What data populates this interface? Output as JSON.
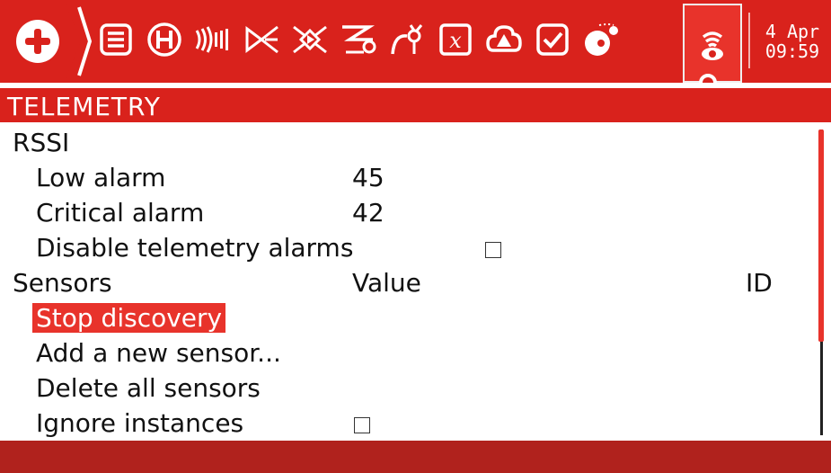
{
  "header": {
    "date": "4 Apr",
    "time": "09:59",
    "tabs": [
      {
        "icon": "checklist-icon"
      },
      {
        "icon": "heli-h-icon"
      },
      {
        "icon": "flight-modes-icon"
      },
      {
        "icon": "inputs-icon"
      },
      {
        "icon": "mixer-icon"
      },
      {
        "icon": "outputs-icon"
      },
      {
        "icon": "curves-icon"
      },
      {
        "icon": "global-variables-icon"
      },
      {
        "icon": "logical-switches-icon"
      },
      {
        "icon": "special-functions-icon"
      },
      {
        "icon": "custom-scripts-icon"
      },
      {
        "icon": "telemetry-icon"
      }
    ],
    "active_tab_index": 11
  },
  "page": {
    "title": "TELEMETRY"
  },
  "rssi": {
    "section_label": "RSSI",
    "low_alarm_label": "Low alarm",
    "low_alarm_value": "45",
    "critical_alarm_label": "Critical alarm",
    "critical_alarm_value": "42",
    "disable_alarms_label": "Disable telemetry alarms",
    "disable_alarms_checked": false
  },
  "sensors": {
    "section_label": "Sensors",
    "value_header": "Value",
    "id_header": "ID",
    "stop_discovery_label": "Stop discovery",
    "add_sensor_label": "Add a new sensor...",
    "delete_all_label": "Delete all sensors",
    "ignore_instances_label": "Ignore instances",
    "ignore_instances_checked": false
  },
  "colors": {
    "accent": "#d9221c",
    "highlight": "#e8332b",
    "footer": "#b0221d"
  }
}
